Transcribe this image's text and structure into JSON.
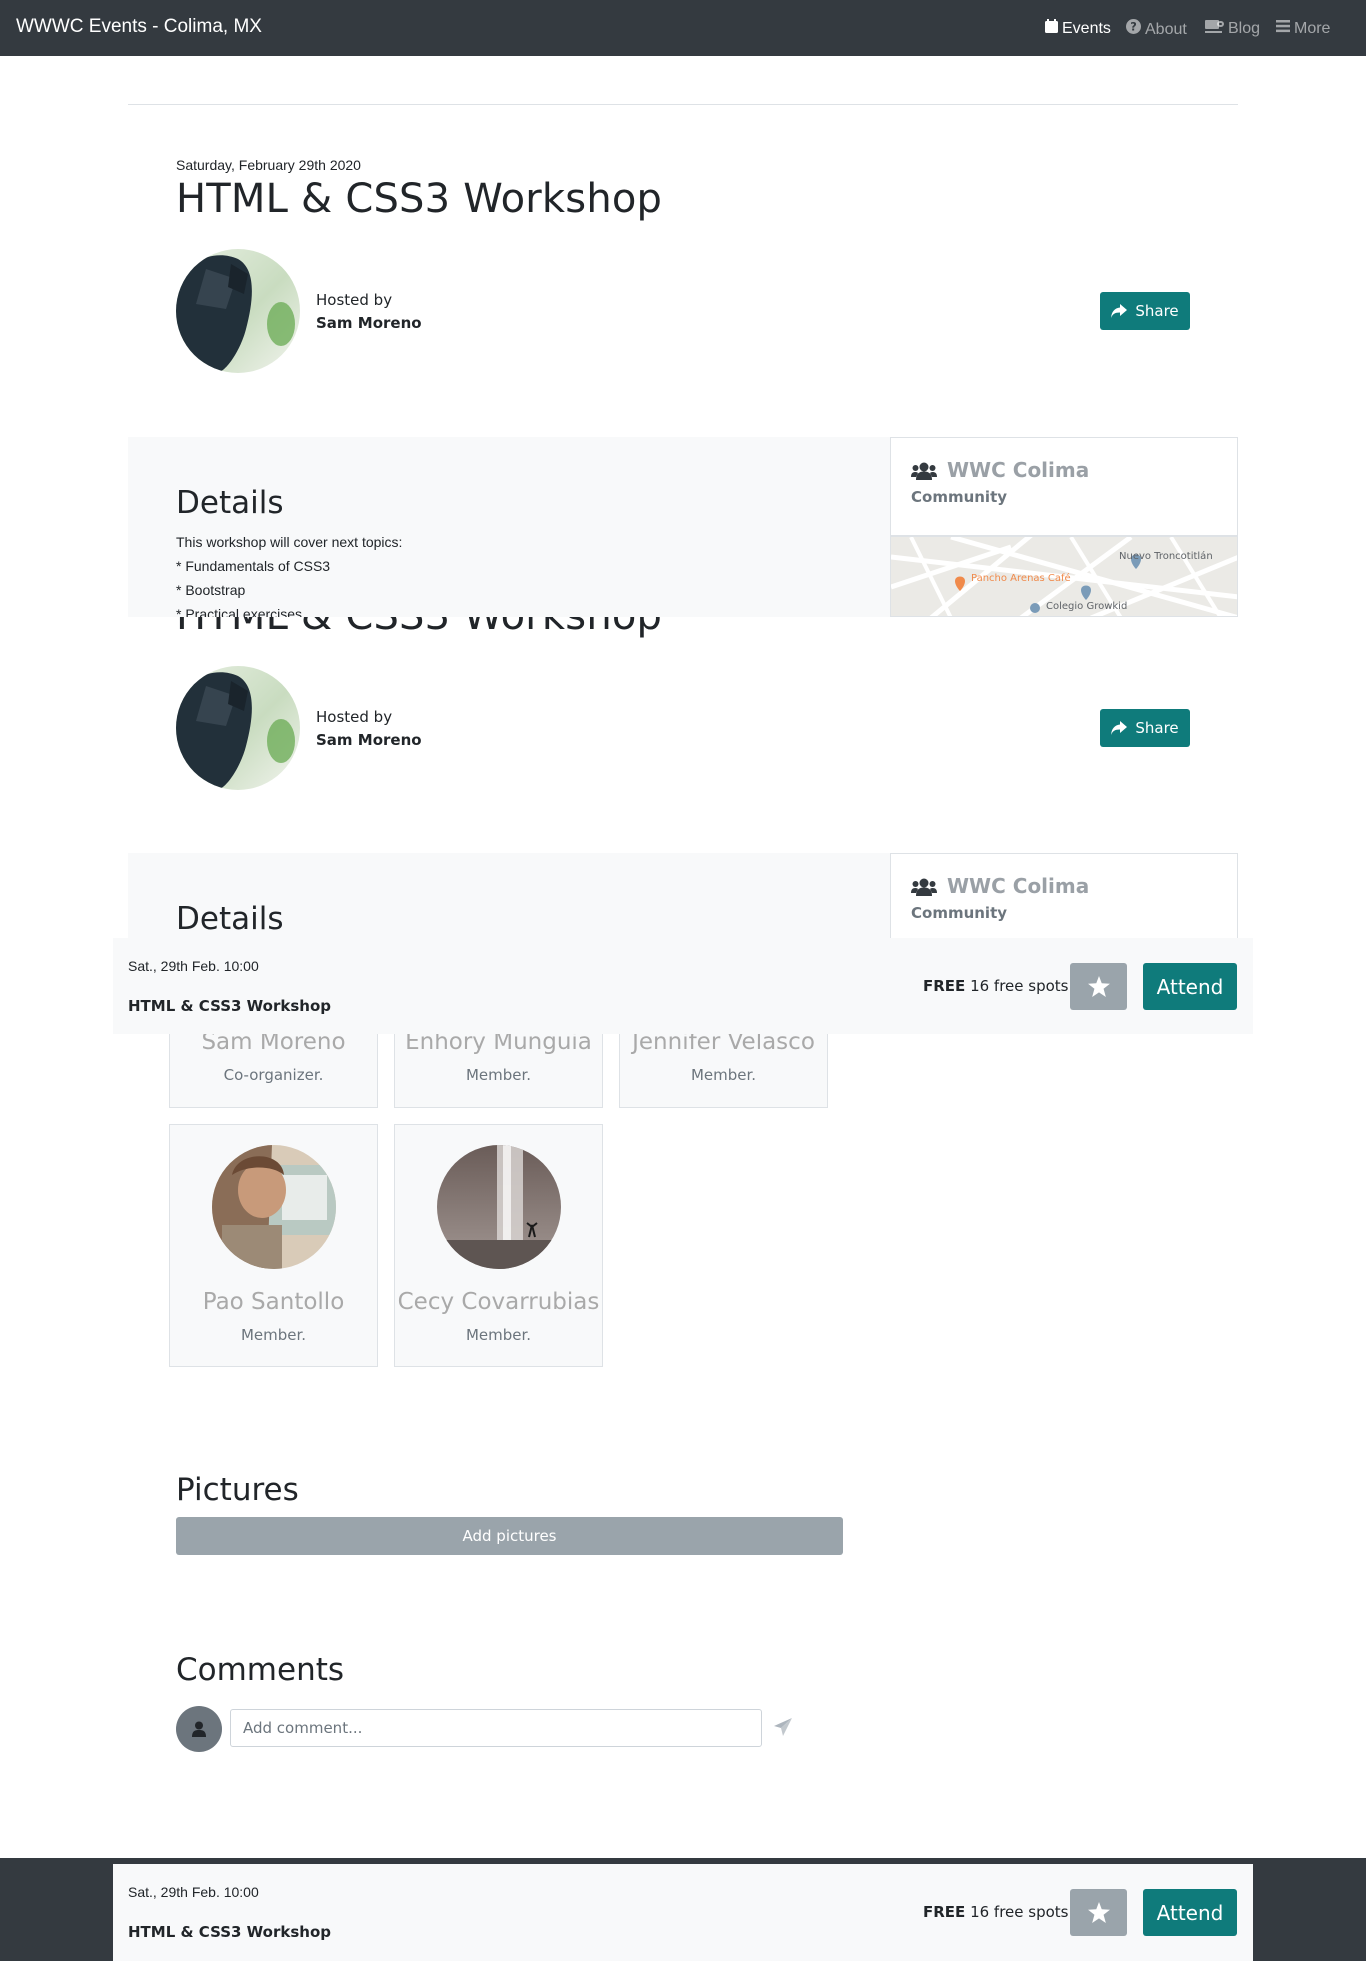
{
  "nav": {
    "brand": "WWWC Events - Colima, MX",
    "links": [
      {
        "label": "Events",
        "icon": "calendar-icon",
        "active": true
      },
      {
        "label": "About",
        "icon": "question-circle-icon",
        "active": false
      },
      {
        "label": "Blog",
        "icon": "coffee-icon",
        "active": false
      },
      {
        "label": "More",
        "icon": "bars-icon",
        "active": false
      }
    ]
  },
  "event": {
    "date": "Saturday, February 29th 2020",
    "title": "HTML & CSS3 Workshop",
    "hosted_label": "Hosted by",
    "host_name": "Sam Moreno",
    "share_label": "Share"
  },
  "details": {
    "heading": "Details",
    "lines": [
      "This workshop will cover next topics:",
      "* Fundamentals of CSS3",
      "* Bootstrap",
      "* Practical exercises"
    ]
  },
  "community": {
    "name": "WWC Colima",
    "subtitle": "Community"
  },
  "map": {
    "places": [
      "Nuevo Troncotitlán",
      "Pancho Arenas Café",
      "Colegio Growkid"
    ]
  },
  "attend_bar": {
    "date": "Sat., 29th Feb. 10:00",
    "title": "HTML & CSS3 Workshop",
    "free_label": "FREE",
    "spots_text": "16 free spots",
    "attend_label": "Attend"
  },
  "members": [
    {
      "name": "Sam Moreno",
      "role": "Co-organizer."
    },
    {
      "name": "Enhory Munguia",
      "role": "Member."
    },
    {
      "name": "Jennifer Velasco",
      "role": "Member."
    },
    {
      "name": "Pao Santollo",
      "role": "Member."
    },
    {
      "name": "Cecy Covarrubias",
      "role": "Member."
    }
  ],
  "pictures": {
    "heading": "Pictures",
    "add_label": "Add pictures"
  },
  "comments": {
    "heading": "Comments",
    "placeholder": "Add comment..."
  },
  "colors": {
    "navbar": "#343a40",
    "accent": "#0f7b7b",
    "muted_button": "#9aa4ab",
    "light_bg": "#f8f9fa"
  }
}
